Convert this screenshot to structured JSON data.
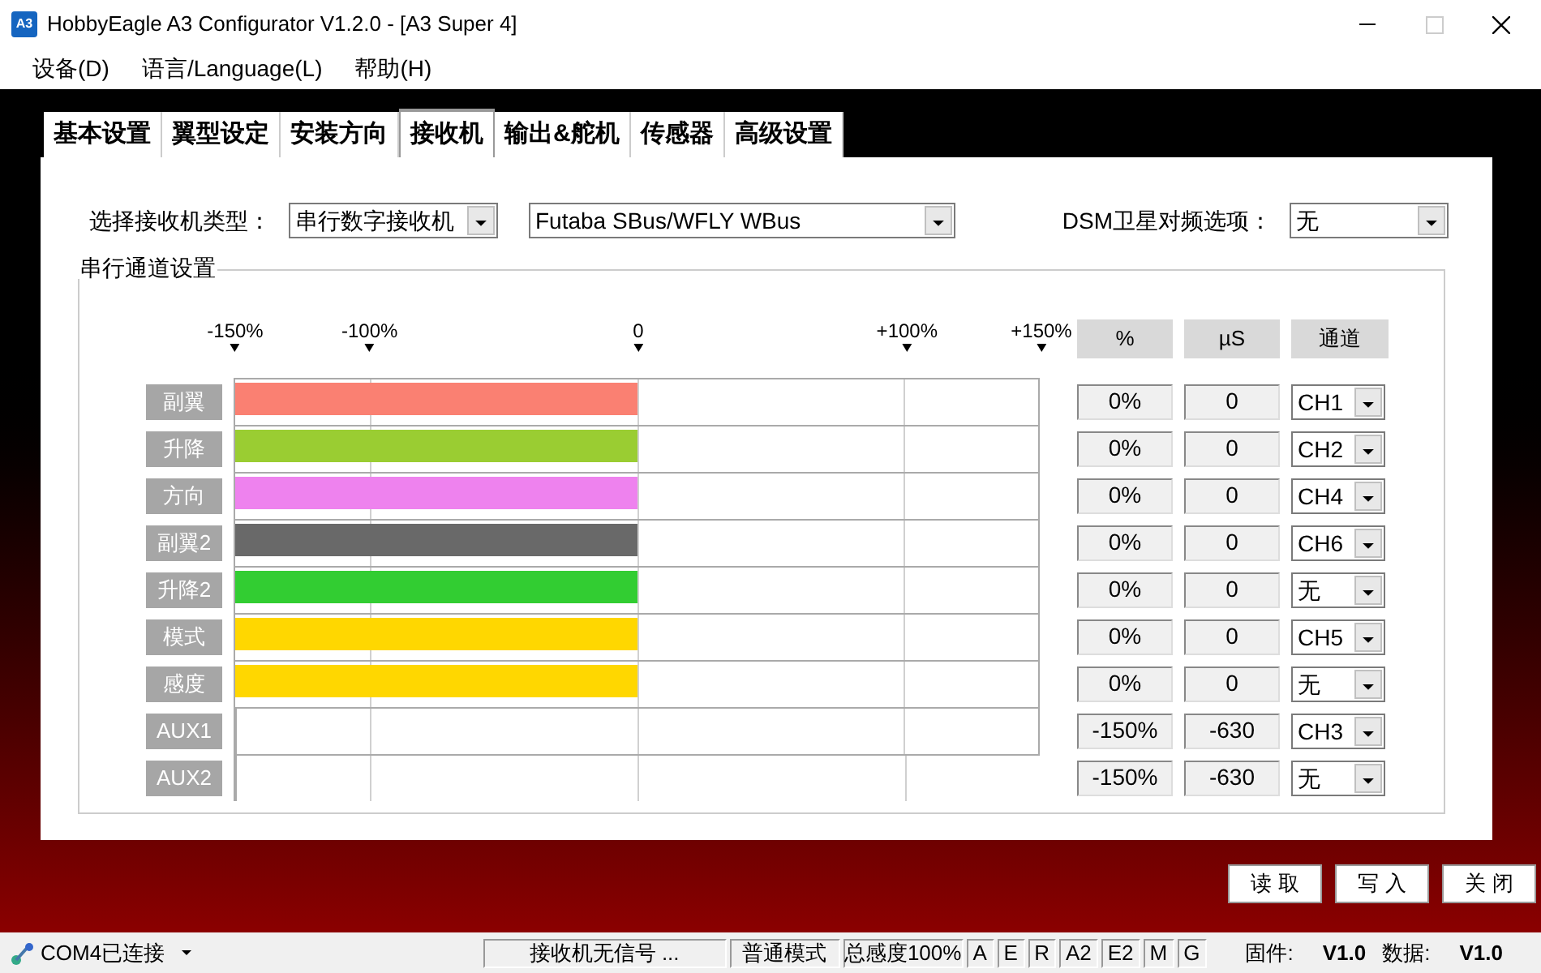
{
  "window": {
    "icon_text": "A3",
    "title": "HobbyEagle A3 Configurator V1.2.0 - [A3 Super 4]"
  },
  "menu": [
    "设备(D)",
    "语言/Language(L)",
    "帮助(H)"
  ],
  "tabs": [
    {
      "label": "基本设置",
      "selected": false
    },
    {
      "label": "翼型设定",
      "selected": false
    },
    {
      "label": "安装方向",
      "selected": false
    },
    {
      "label": "接收机",
      "selected": true
    },
    {
      "label": "输出&舵机",
      "selected": false
    },
    {
      "label": "传感器",
      "selected": false
    },
    {
      "label": "高级设置",
      "selected": false
    }
  ],
  "receiver": {
    "type_label": "选择接收机类型：",
    "type_value": "串行数字接收机",
    "protocol_value": "Futaba SBus/WFLY WBus",
    "dsm_label": "DSM卫星对频选项：",
    "dsm_value": "无"
  },
  "group": {
    "title": "串行通道设置",
    "ticks": [
      "-150%",
      "-100%",
      "0",
      "+100%",
      "+150%"
    ],
    "columns": [
      "%",
      "µS",
      "通道"
    ],
    "channels": [
      {
        "name": "副翼",
        "level": 0.5,
        "color": "#fa8072",
        "percent": "0%",
        "us": "0",
        "channel": "CH1"
      },
      {
        "name": "升降",
        "level": 0.5,
        "color": "#9acd32",
        "percent": "0%",
        "us": "0",
        "channel": "CH2"
      },
      {
        "name": "方向",
        "level": 0.5,
        "color": "#ee82ee",
        "percent": "0%",
        "us": "0",
        "channel": "CH4"
      },
      {
        "name": "副翼2",
        "level": 0.5,
        "color": "#696969",
        "percent": "0%",
        "us": "0",
        "channel": "CH6"
      },
      {
        "name": "升降2",
        "level": 0.5,
        "color": "#32cd32",
        "percent": "0%",
        "us": "0",
        "channel": "无"
      },
      {
        "name": "模式",
        "level": 0.5,
        "color": "#ffd700",
        "percent": "0%",
        "us": "0",
        "channel": "CH5"
      },
      {
        "name": "感度",
        "level": 0.5,
        "color": "#ffd700",
        "percent": "0%",
        "us": "0",
        "channel": "无"
      },
      {
        "name": "AUX1",
        "level": 0,
        "percent": "-150%",
        "us": "-630",
        "channel": "CH3"
      },
      {
        "name": "AUX2",
        "level": 0,
        "percent": "-150%",
        "us": "-630",
        "channel": "无"
      }
    ]
  },
  "buttons": [
    "读 取",
    "写 入",
    "关 闭"
  ],
  "status_bar": {
    "connection": "COM4已连接",
    "signal": "接收机无信号 ...",
    "mode": "普通模式",
    "gain": "总感度100%",
    "flags": [
      "A",
      "E",
      "R",
      "A2",
      "E2",
      "M",
      "G"
    ],
    "firmware_label": "固件:",
    "firmware": "V1.0",
    "data_label": "数据:",
    "data": "V1.0"
  }
}
